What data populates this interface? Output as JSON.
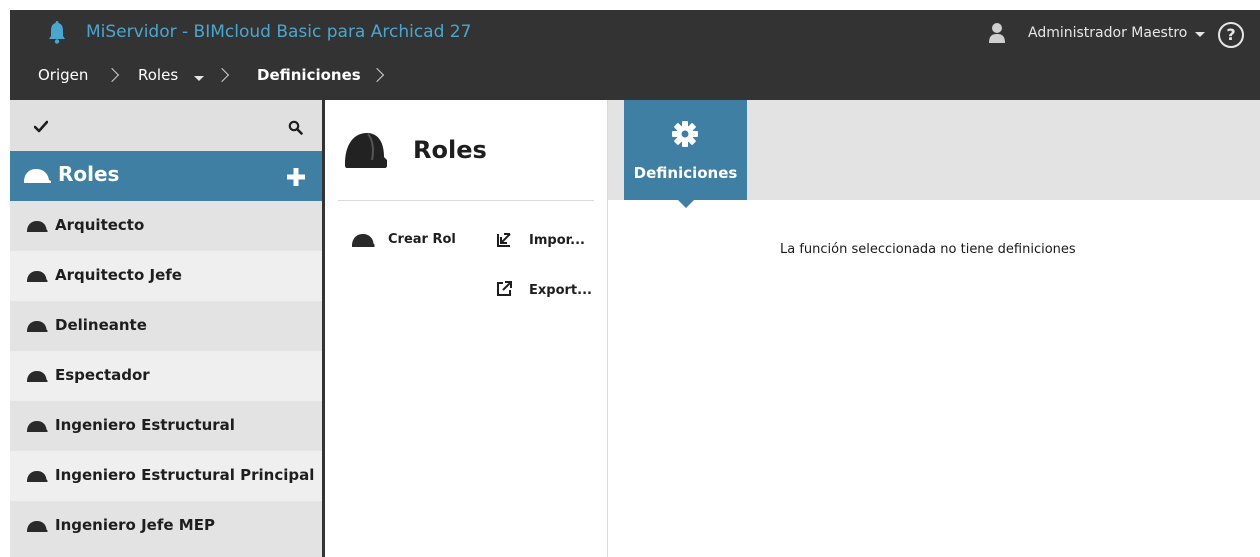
{
  "header": {
    "app_title": "MiServidor - BIMcloud Basic para Archicad 27",
    "user_name": "Administrador Maestro",
    "help_label": "?",
    "accent_color": "#4ba6cf"
  },
  "breadcrumb": {
    "items": [
      {
        "label": "Origen"
      },
      {
        "label": "Roles"
      },
      {
        "label": "Definiciones"
      }
    ]
  },
  "sidebar": {
    "header_label": "Roles",
    "header_color": "#3f7fa3",
    "items": [
      {
        "label": "Arquitecto"
      },
      {
        "label": "Arquitecto Jefe"
      },
      {
        "label": "Delineante"
      },
      {
        "label": "Espectador"
      },
      {
        "label": "Ingeniero Estructural"
      },
      {
        "label": "Ingeniero Estructural Principal"
      },
      {
        "label": "Ingeniero Jefe MEP"
      }
    ]
  },
  "middle": {
    "title": "Roles",
    "actions": {
      "create": "Crear Rol",
      "import": "Impor...",
      "export": "Export..."
    }
  },
  "content": {
    "tab_label": "Definiciones",
    "empty_message": "La función seleccionada no tiene definiciones"
  }
}
